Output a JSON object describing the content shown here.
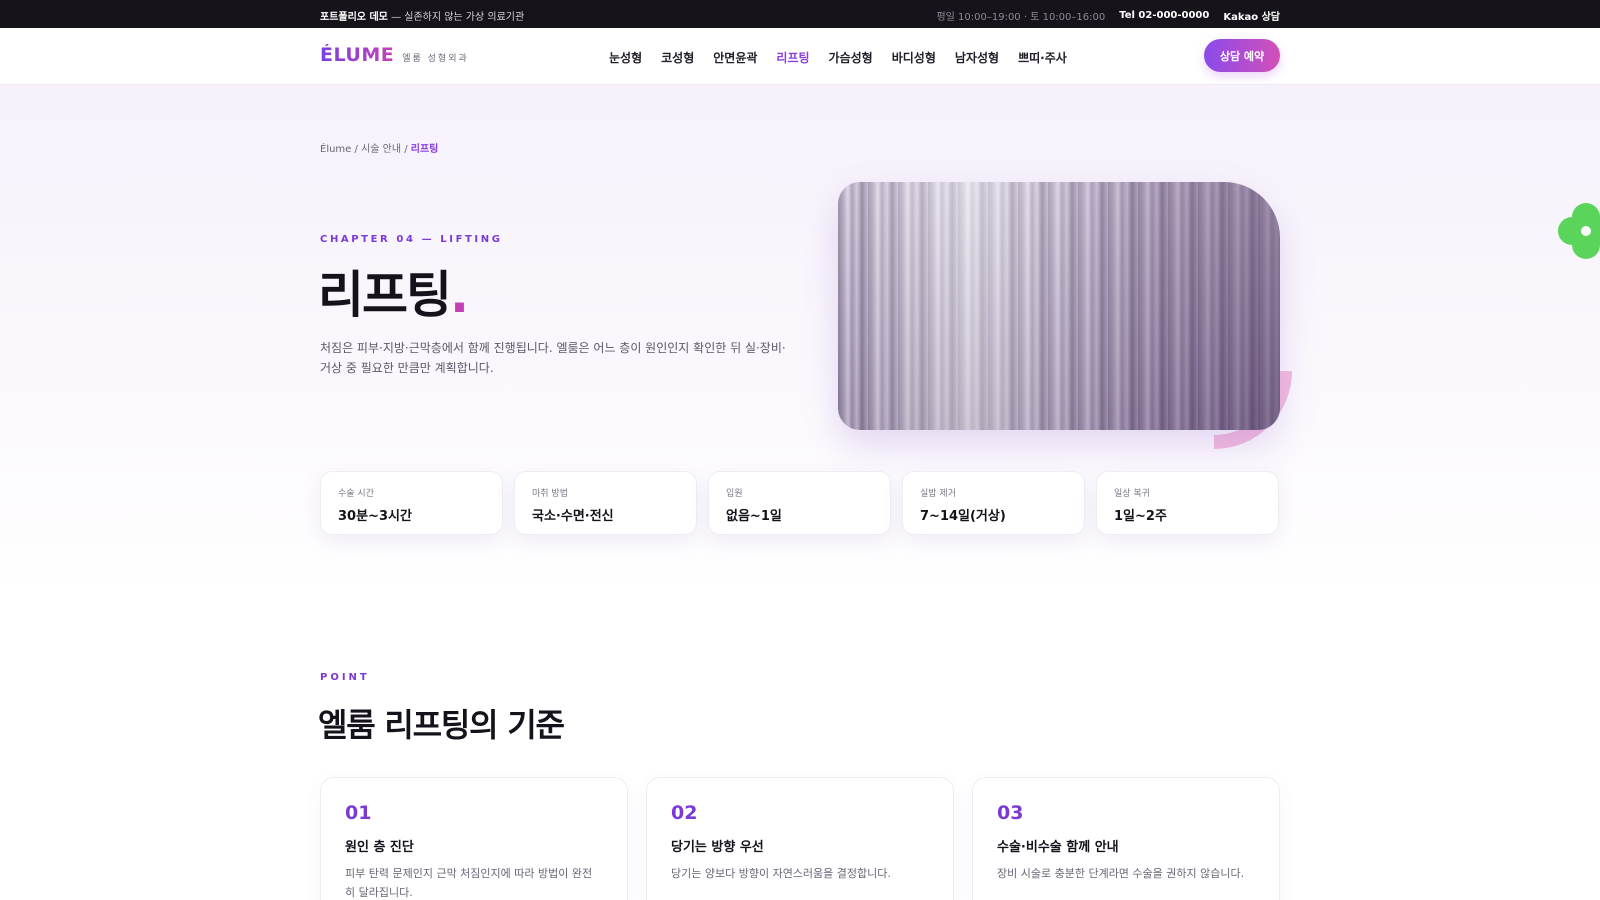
{
  "topbar": {
    "brand": "포트폴리오 데모",
    "tagline": " — 실존하지 않는 가상 의료기관",
    "hours": "평일 10:00–19:00 · 토 10:00–16:00",
    "tel": "Tel 02-000-0000",
    "kakao": "Kakao 상담"
  },
  "nav": {
    "logo": "ÉLUME",
    "logo_sub": "엘룸 성형외과",
    "menu": [
      "눈성형",
      "코성형",
      "안면윤곽",
      "리프팅",
      "가슴성형",
      "바디성형",
      "남자성형",
      "쁘띠·주사"
    ],
    "active_index": 3,
    "cta": "상담 예약"
  },
  "breadcrumb": {
    "root": "Élume",
    "sep1": " / ",
    "section": "시술 안내",
    "sep2": " / ",
    "current": "리프팅"
  },
  "hero": {
    "chapter": "CHAPTER 04 — LIFTING",
    "title": "리프팅",
    "title_dot": ".",
    "description": "처짐은 피부·지방·근막층에서 함께 진행됩니다. 엘룸은 어느 층이 원인인지 확인한 뒤 실·장비·거상 중 필요한 만큼만 계획합니다."
  },
  "info": [
    {
      "label": "수술 시간",
      "value": "30분~3시간"
    },
    {
      "label": "마취 방법",
      "value": "국소·수면·전신"
    },
    {
      "label": "입원",
      "value": "없음~1일"
    },
    {
      "label": "실밥 제거",
      "value": "7~14일(거상)"
    },
    {
      "label": "일상 복귀",
      "value": "1일~2주"
    }
  ],
  "point": {
    "eyebrow": "POINT",
    "title": "엘룸 리프팅의 기준",
    "cards": [
      {
        "num": "01",
        "title": "원인 층 진단",
        "desc": "피부 탄력 문제인지 근막 처짐인지에 따라 방법이 완전히 달라집니다."
      },
      {
        "num": "02",
        "title": "당기는 방향 우선",
        "desc": "당기는 양보다 방향이 자연스러움을 결정합니다."
      },
      {
        "num": "03",
        "title": "수술·비수술 함께 안내",
        "desc": "장비 시술로 충분한 단계라면 수술을 권하지 않습니다."
      }
    ]
  },
  "colors": {
    "accent": "#7a3ad6",
    "accent_pink": "#c43fb6",
    "topbar_bg": "#16131a",
    "decor_green": "#5bd45b",
    "decor_pink": "#f1b6db"
  }
}
